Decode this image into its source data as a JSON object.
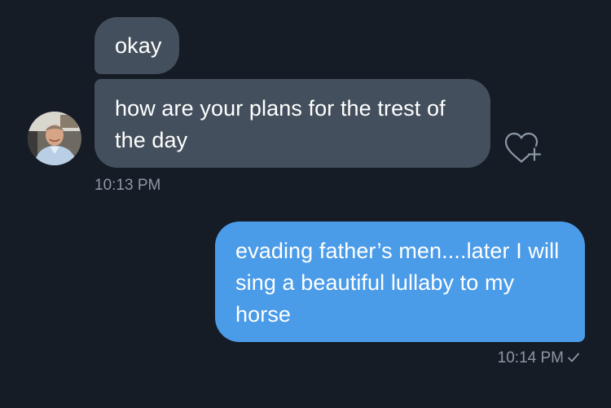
{
  "conversation": {
    "incoming": [
      {
        "text": "okay"
      },
      {
        "text": "how are your plans for the trest of the day"
      }
    ],
    "incoming_time": "10:13 PM",
    "outgoing": [
      {
        "text": "evading father’s men....later I will sing a beautiful lullaby to my horse"
      }
    ],
    "outgoing_time": "10:14 PM"
  },
  "icons": {
    "avatar": "user-avatar-photo",
    "like": "heart-plus-icon",
    "status": "checkmark-icon"
  },
  "colors": {
    "background": "#161c26",
    "incoming_bubble": "#434f5c",
    "outgoing_bubble": "#4a9be8",
    "timestamp": "#8b98a5",
    "text": "#ffffff"
  }
}
